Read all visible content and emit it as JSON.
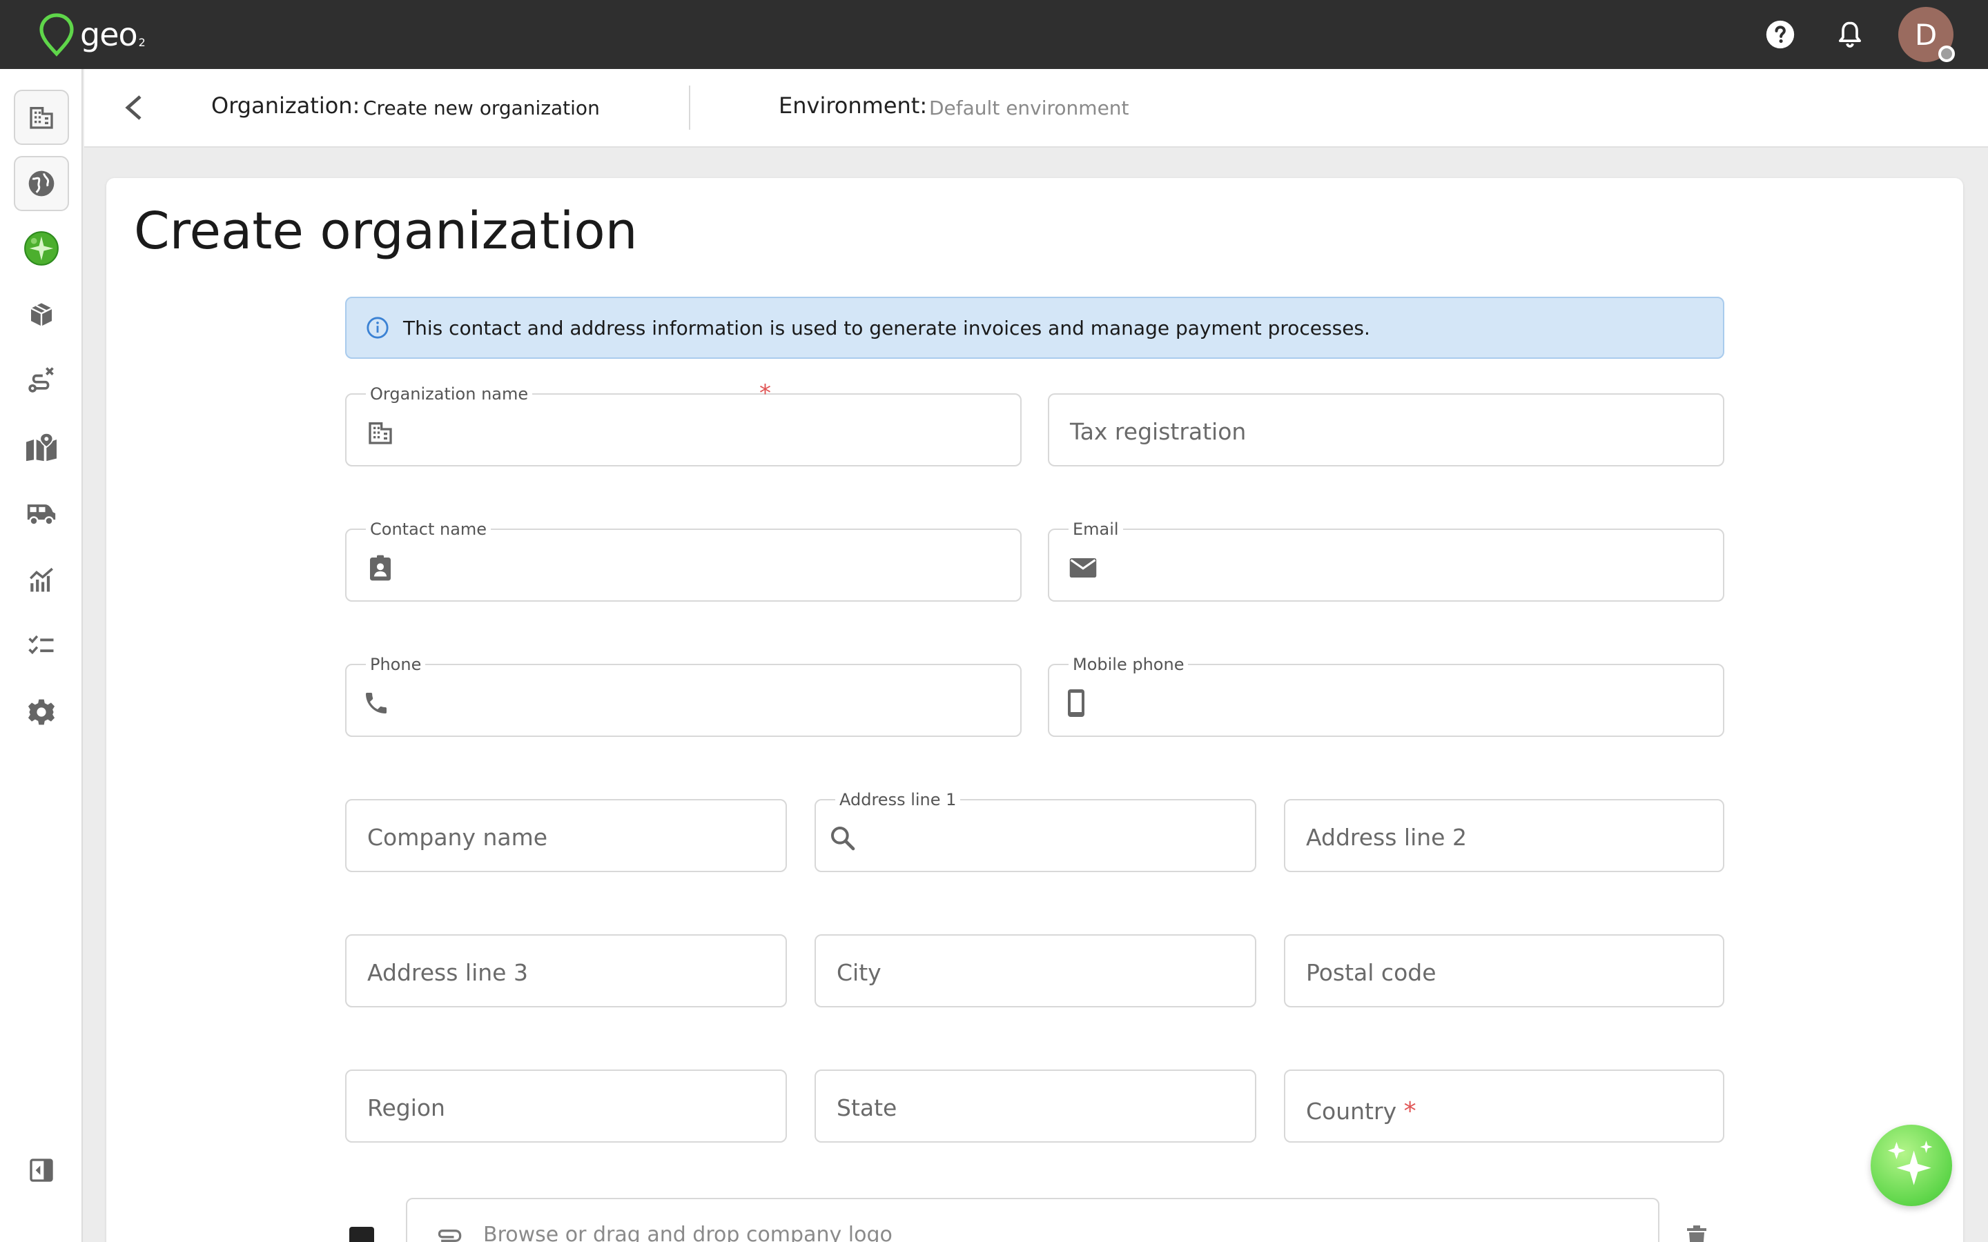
{
  "app": {
    "logo_text": "geo",
    "logo_sub": "2",
    "avatar_initial": "D",
    "accent": "#4caf2e"
  },
  "header_icons": [
    "help-icon",
    "bell-icon"
  ],
  "sidebar": {
    "items": [
      {
        "icon": "organization-icon",
        "selected": true
      },
      {
        "icon": "globe-icon",
        "selected": true
      },
      {
        "icon": "environment-globe-icon",
        "selected": false
      },
      {
        "icon": "package-icon",
        "selected": false
      },
      {
        "icon": "route-icon",
        "selected": false
      },
      {
        "icon": "map-pin-icon",
        "selected": false
      },
      {
        "icon": "vehicle-icon",
        "selected": false
      },
      {
        "icon": "analytics-icon",
        "selected": false
      },
      {
        "icon": "checklist-icon",
        "selected": false
      },
      {
        "icon": "settings-icon",
        "selected": false
      }
    ],
    "collapse_icon": "collapse-sidebar-icon"
  },
  "subheader": {
    "org_label": "Organization:",
    "org_value": "Create new organization",
    "env_label": "Environment:",
    "env_value": "Default environment"
  },
  "page": {
    "title": "Create organization",
    "info": "This contact and address information is used to generate invoices and manage payment processes."
  },
  "form": {
    "organization_name": {
      "label": "Organization name",
      "required_mark": "*"
    },
    "tax_registration": {
      "placeholder": "Tax registration"
    },
    "contact_name": {
      "label": "Contact name"
    },
    "email": {
      "label": "Email"
    },
    "phone": {
      "label": "Phone"
    },
    "mobile_phone": {
      "label": "Mobile phone"
    },
    "company_name": {
      "placeholder": "Company name"
    },
    "address_line_1": {
      "label": "Address line 1"
    },
    "address_line_2": {
      "placeholder": "Address line 2"
    },
    "address_line_3": {
      "placeholder": "Address line 3"
    },
    "city": {
      "placeholder": "City"
    },
    "postal_code": {
      "placeholder": "Postal code"
    },
    "region": {
      "placeholder": "Region"
    },
    "state": {
      "placeholder": "State"
    },
    "country": {
      "placeholder": "Country",
      "required_mark": "*"
    },
    "logo_upload": {
      "placeholder": "Browse or drag and drop company logo"
    }
  }
}
